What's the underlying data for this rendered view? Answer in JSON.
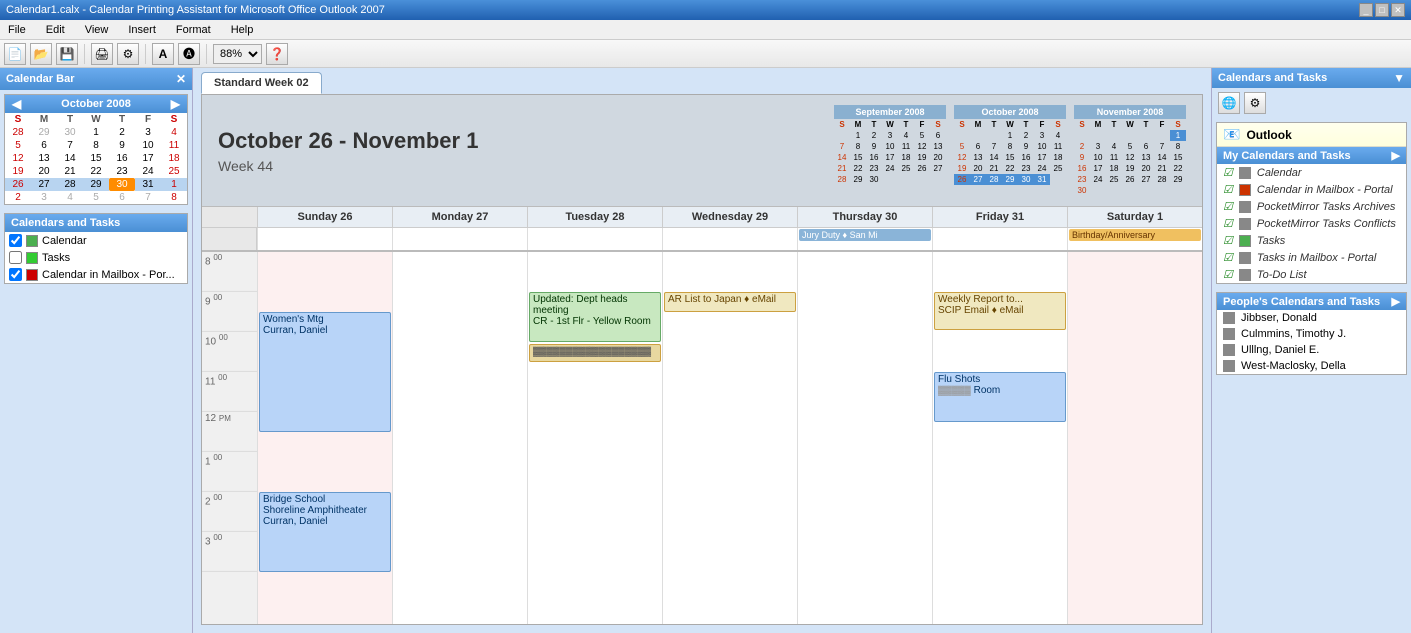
{
  "titleBar": {
    "title": "Calendar1.calx - Calendar Printing Assistant for Microsoft Office Outlook 2007",
    "controls": [
      "minimize",
      "maximize",
      "close"
    ]
  },
  "menuBar": {
    "items": [
      "File",
      "Edit",
      "View",
      "Insert",
      "Format",
      "Help"
    ]
  },
  "toolbar": {
    "zoom": "88%",
    "buttons": [
      "new",
      "open",
      "save",
      "print",
      "help"
    ]
  },
  "sidebar": {
    "title": "Calendar Bar",
    "miniCal": {
      "month": "October 2008",
      "days_header": [
        "S",
        "M",
        "T",
        "W",
        "T",
        "F",
        "S"
      ],
      "weeks": [
        [
          "28",
          "29",
          "30",
          "1",
          "2",
          "3",
          "4"
        ],
        [
          "5",
          "6",
          "7",
          "8",
          "9",
          "10",
          "11"
        ],
        [
          "12",
          "13",
          "14",
          "15",
          "16",
          "17",
          "18"
        ],
        [
          "19",
          "20",
          "21",
          "22",
          "23",
          "24",
          "25"
        ],
        [
          "26",
          "27",
          "28",
          "29",
          "30",
          "31",
          "1"
        ],
        [
          "2",
          "3",
          "4",
          "5",
          "6",
          "7",
          "8"
        ]
      ],
      "today": "30",
      "selectedWeek": 4
    },
    "calTasksHeader": "Calendars and Tasks",
    "items": [
      {
        "checked": true,
        "color": "green",
        "label": "Calendar"
      },
      {
        "checked": false,
        "color": "task",
        "label": "Tasks"
      },
      {
        "checked": true,
        "color": "red",
        "label": "Calendar in Mailbox - Por..."
      }
    ]
  },
  "tab": {
    "label": "Standard Week 02"
  },
  "calView": {
    "dateRange": "October 26 - November 1",
    "weekLabel": "Week 44",
    "miniCals": [
      {
        "title": "September 2008",
        "header": [
          "S",
          "M",
          "T",
          "W",
          "T",
          "F",
          "S"
        ],
        "weeks": [
          [
            "",
            "1",
            "2",
            "3",
            "4",
            "5",
            "6"
          ],
          [
            "7",
            "8",
            "9",
            "10",
            "11",
            "12",
            "13"
          ],
          [
            "14",
            "15",
            "16",
            "17",
            "18",
            "19",
            "20"
          ],
          [
            "21",
            "22",
            "23",
            "24",
            "25",
            "26",
            "27"
          ],
          [
            "28",
            "29",
            "30",
            "",
            "",
            "",
            ""
          ]
        ]
      },
      {
        "title": "October 2008",
        "header": [
          "S",
          "M",
          "T",
          "W",
          "T",
          "F",
          "S"
        ],
        "weeks": [
          [
            "",
            "",
            "",
            "1",
            "2",
            "3",
            "4"
          ],
          [
            "5",
            "6",
            "7",
            "8",
            "9",
            "10",
            "11"
          ],
          [
            "12",
            "13",
            "14",
            "15",
            "16",
            "17",
            "18"
          ],
          [
            "19",
            "20",
            "21",
            "22",
            "23",
            "24",
            "25"
          ],
          [
            "26",
            "27",
            "28",
            "29",
            "30",
            "31",
            ""
          ],
          [
            "",
            "",
            "",
            "",
            "",
            "",
            ""
          ]
        ]
      },
      {
        "title": "November 2008",
        "header": [
          "S",
          "M",
          "T",
          "W",
          "T",
          "F",
          "S"
        ],
        "weeks": [
          [
            "",
            "",
            "",
            "",
            "",
            "",
            "1"
          ],
          [
            "2",
            "3",
            "4",
            "5",
            "6",
            "7",
            "8"
          ],
          [
            "9",
            "10",
            "11",
            "12",
            "13",
            "14",
            "15"
          ],
          [
            "16",
            "17",
            "18",
            "19",
            "20",
            "21",
            "22"
          ],
          [
            "23",
            "24",
            "25",
            "26",
            "27",
            "28",
            "29"
          ],
          [
            "30",
            "",
            "",
            "",
            "",
            "",
            ""
          ]
        ]
      }
    ],
    "days": [
      {
        "label": "Sunday 26",
        "short": "sun26"
      },
      {
        "label": "Monday 27",
        "short": "mon27"
      },
      {
        "label": "Tuesday 28",
        "short": "tue28"
      },
      {
        "label": "Wednesday 29",
        "short": "wed29"
      },
      {
        "label": "Thursday 30",
        "short": "thu30"
      },
      {
        "label": "Friday 31",
        "short": "fri31"
      },
      {
        "label": "Saturday 1",
        "short": "sat1"
      }
    ],
    "timeSlots": [
      "8",
      "9",
      "10",
      "11",
      "12 PM",
      "1",
      "2"
    ],
    "allDayEvents": [
      {
        "day": "thu",
        "label": "Jury Duty ♦ San Mi",
        "type": "header"
      },
      {
        "day": "sat",
        "label": "Birthday/Anniversary",
        "type": "orange"
      }
    ],
    "events": [
      {
        "day": "sun",
        "label": "Women's Mtg\nCurran, Daniel",
        "startHour": 9.5,
        "endHour": 12.5,
        "type": "blue"
      },
      {
        "day": "tue",
        "label": "Updated: Dept heads meeting\nCR - 1st Flr - Yellow Room",
        "startHour": 9,
        "endHour": 10,
        "type": "green"
      },
      {
        "day": "tue",
        "label": "",
        "startHour": 10,
        "endHour": 10.5,
        "type": "tan"
      },
      {
        "day": "wed",
        "label": "AR List to Japan ♦ eMail",
        "startHour": 9,
        "endHour": 9.5,
        "type": "tan"
      },
      {
        "day": "fri",
        "label": "Weekly Report to...\nSCIP Email ♦ eMail",
        "startHour": 9,
        "endHour": 9.75,
        "type": "tan"
      },
      {
        "day": "fri",
        "label": "Flu Shots\n... Room",
        "startHour": 11,
        "endHour": 12,
        "type": "blue"
      },
      {
        "day": "sun",
        "label": "Bridge School\nShoreline Amphitheater\nCurran, Daniel",
        "startHour": 14,
        "endHour": 16,
        "type": "blue"
      }
    ]
  },
  "rightPanel": {
    "title": "Calendars and Tasks",
    "outlook": {
      "label": "Outlook",
      "myCalHeader": "My Calendars and Tasks",
      "items": [
        {
          "label": "Calendar",
          "check": true,
          "color": "gray"
        },
        {
          "label": "Calendar in Mailbox - Portal",
          "check": true,
          "color": "red"
        },
        {
          "label": "PocketMirror Tasks Archives",
          "check": true,
          "color": "gray"
        },
        {
          "label": "PocketMirror Tasks Conflicts",
          "check": true,
          "color": "gray"
        },
        {
          "label": "Tasks",
          "check": true,
          "color": "green"
        },
        {
          "label": "Tasks in Mailbox - Portal",
          "check": true,
          "color": "gray"
        },
        {
          "label": "To-Do List",
          "check": true,
          "color": "gray"
        }
      ],
      "peopleHeader": "People's Calendars and Tasks",
      "people": [
        {
          "label": "Jibbser, Donald",
          "color": "gray"
        },
        {
          "label": "Culmmins, Timothy J.",
          "color": "gray"
        },
        {
          "label": "Ulllng, Daniel E.",
          "color": "gray"
        },
        {
          "label": "West-Maclosky, Della",
          "color": "gray"
        }
      ]
    }
  }
}
